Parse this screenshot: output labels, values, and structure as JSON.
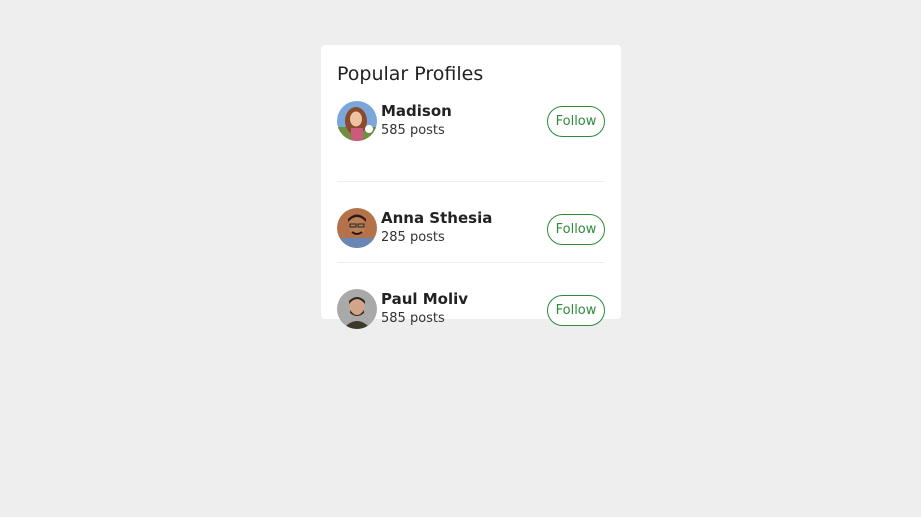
{
  "card": {
    "title": "Popular Profiles"
  },
  "profiles": [
    {
      "name": "Madison",
      "posts": "585 posts",
      "follow_label": "Follow"
    },
    {
      "name": "Anna Sthesia",
      "posts": "285 posts",
      "follow_label": "Follow"
    },
    {
      "name": "Paul Moliv",
      "posts": "585 posts",
      "follow_label": "Follow"
    }
  ],
  "colors": {
    "background": "#eeeeee",
    "card": "#ffffff",
    "accent": "#2e8b3a",
    "text": "#222222"
  }
}
